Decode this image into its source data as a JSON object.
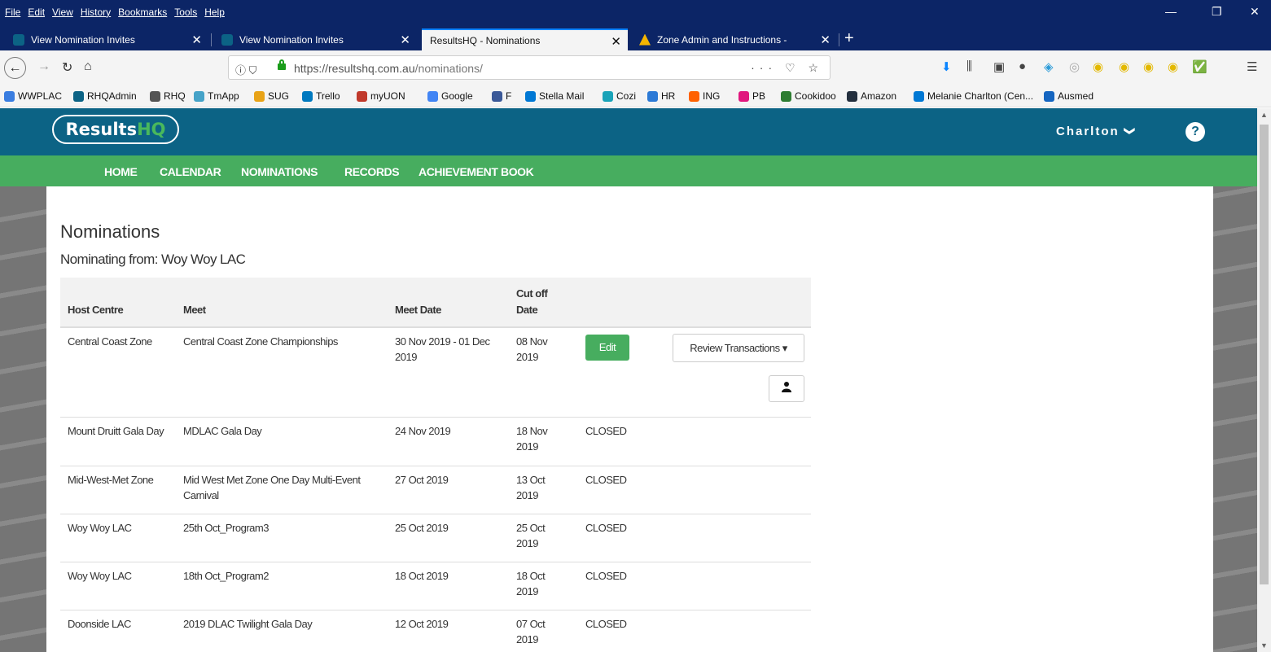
{
  "browser": {
    "menu": [
      "File",
      "Edit",
      "View",
      "History",
      "Bookmarks",
      "Tools",
      "Help"
    ],
    "window_controls": {
      "minimize": "—",
      "restore": "❐",
      "close": "✕"
    },
    "tabs": [
      {
        "title": "View Nomination Invites",
        "favicon_color": "#0c6385",
        "active": false
      },
      {
        "title": "View Nomination Invites",
        "favicon_color": "#0c6385",
        "active": false
      },
      {
        "title": "ResultsHQ - Nominations",
        "favicon_color": "",
        "active": true
      },
      {
        "title": "Zone Admin and Instructions - ",
        "favicon_color": "#f4b400",
        "active": false
      }
    ],
    "tab_close": "✕",
    "new_tab": "+",
    "url_scheme_host": "https://resultshq.com.au",
    "url_path": "/nominations/",
    "url_actions": "··· ♡ ☆",
    "bookmarks": [
      {
        "label": "WWPLAC",
        "color": "#3a7de0"
      },
      {
        "label": "RHQAdmin",
        "color": "#0c6385"
      },
      {
        "label": "RHQ",
        "color": "#555555"
      },
      {
        "label": "TmApp",
        "color": "#46a3c8"
      },
      {
        "label": "SUG",
        "color": "#e8a317"
      },
      {
        "label": "Trello",
        "color": "#0079bf"
      },
      {
        "label": "myUON",
        "color": "#c0392b"
      },
      {
        "label": "Google",
        "color": "#4285f4"
      },
      {
        "label": "F",
        "color": "#3b5998"
      },
      {
        "label": "Stella Mail",
        "color": "#0078d4"
      },
      {
        "label": "Cozi",
        "color": "#1aa3b8"
      },
      {
        "label": "HR",
        "color": "#2c7ad6"
      },
      {
        "label": "ING",
        "color": "#ff6200"
      },
      {
        "label": "PB",
        "color": "#e0177e"
      },
      {
        "label": "Cookidoo",
        "color": "#2e7d32"
      },
      {
        "label": "Amazon",
        "color": "#232f3e"
      },
      {
        "label": "Melanie Charlton (Cen...",
        "color": "#0078d4"
      },
      {
        "label": "Ausmed",
        "color": "#1565c0"
      }
    ]
  },
  "site": {
    "logo_main": "Results",
    "logo_accent": "HQ",
    "user_menu": "Charlton",
    "user_caret": "❯",
    "help": "?",
    "nav": [
      "HOME",
      "CALENDAR",
      "NOMINATIONS",
      "RECORDS",
      "ACHIEVEMENT BOOK"
    ]
  },
  "main": {
    "title": "Nominations",
    "subtitle": "Nominating from: Woy Woy LAC",
    "columns": {
      "host": "Host Centre",
      "meet": "Meet",
      "meet_date": "Meet Date",
      "cutoff_line1": "Cut off",
      "cutoff_line2": "Date"
    },
    "edit_label": "Edit",
    "review_label": "Review Transactions ▾",
    "rows": [
      {
        "host": "Central Coast Zone",
        "meet": "Central Coast Zone Championships",
        "meet_date": "30 Nov 2019 - 01 Dec 2019",
        "cutoff": "08 Nov 2019",
        "status": ""
      },
      {
        "host": "Mount Druitt Gala Day",
        "meet": "MDLAC Gala Day",
        "meet_date": "24 Nov 2019",
        "cutoff": "18 Nov 2019",
        "status": "CLOSED"
      },
      {
        "host": "Mid-West-Met Zone",
        "meet": "Mid West Met Zone One Day Multi-Event Carnival",
        "meet_date": "27 Oct 2019",
        "cutoff": "13 Oct 2019",
        "status": "CLOSED"
      },
      {
        "host": "Woy Woy LAC",
        "meet": "25th Oct_Program3",
        "meet_date": "25 Oct 2019",
        "cutoff": "25 Oct 2019",
        "status": "CLOSED"
      },
      {
        "host": "Woy Woy LAC",
        "meet": "18th Oct_Program2",
        "meet_date": "18 Oct 2019",
        "cutoff": "18 Oct 2019",
        "status": "CLOSED"
      },
      {
        "host": "Doonside LAC",
        "meet": "2019 DLAC Twilight Gala Day",
        "meet_date": "12 Oct 2019",
        "cutoff": "07 Oct 2019",
        "status": "CLOSED"
      }
    ]
  }
}
